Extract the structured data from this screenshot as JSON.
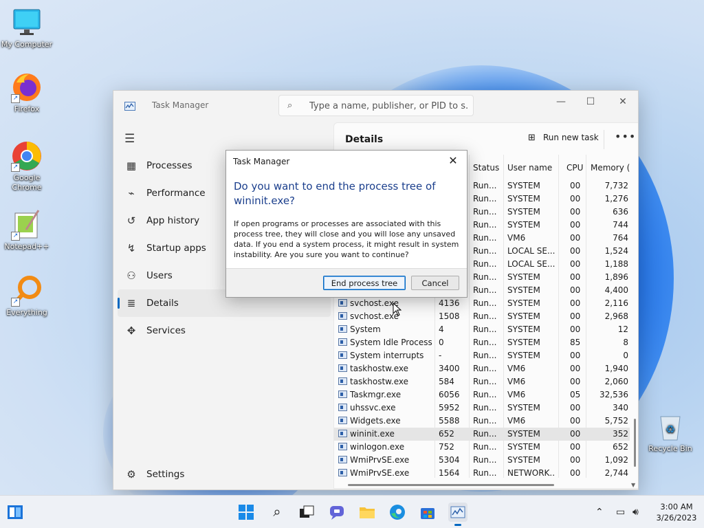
{
  "desktop": {
    "icons": [
      {
        "label": "My Computer"
      },
      {
        "label": "Firefox"
      },
      {
        "label": "Google Chrome"
      },
      {
        "label": "Notepad++"
      },
      {
        "label": "Everything"
      },
      {
        "label": "Recycle Bin"
      }
    ]
  },
  "window": {
    "title": "Task Manager",
    "search_placeholder": "Type a name, publisher, or PID to s..."
  },
  "nav": {
    "items": [
      {
        "label": "Processes"
      },
      {
        "label": "Performance"
      },
      {
        "label": "App history"
      },
      {
        "label": "Startup apps"
      },
      {
        "label": "Users"
      },
      {
        "label": "Details"
      },
      {
        "label": "Services"
      }
    ],
    "settings": "Settings"
  },
  "details": {
    "title": "Details",
    "run_new_task": "Run new task",
    "more": "•••",
    "columns": {
      "status": "Status",
      "user": "User name",
      "cpu": "CPU",
      "memory": "Memory ("
    },
    "rows": [
      {
        "name": "",
        "pid": "",
        "status": "Run...",
        "user": "SYSTEM",
        "cpu": "00",
        "mem": "7,732"
      },
      {
        "name": "",
        "pid": "",
        "status": "Run...",
        "user": "SYSTEM",
        "cpu": "00",
        "mem": "1,276"
      },
      {
        "name": "",
        "pid": "",
        "status": "Run...",
        "user": "SYSTEM",
        "cpu": "00",
        "mem": "636"
      },
      {
        "name": "",
        "pid": "",
        "status": "Run...",
        "user": "SYSTEM",
        "cpu": "00",
        "mem": "744"
      },
      {
        "name": "",
        "pid": "",
        "status": "Run...",
        "user": "VM6",
        "cpu": "00",
        "mem": "764"
      },
      {
        "name": "",
        "pid": "",
        "status": "Run...",
        "user": "LOCAL SE...",
        "cpu": "00",
        "mem": "1,524"
      },
      {
        "name": "",
        "pid": "",
        "status": "Run...",
        "user": "LOCAL SE...",
        "cpu": "00",
        "mem": "1,188"
      },
      {
        "name": "",
        "pid": "",
        "status": "Run...",
        "user": "SYSTEM",
        "cpu": "00",
        "mem": "1,896"
      },
      {
        "name": "",
        "pid": "",
        "status": "Run...",
        "user": "SYSTEM",
        "cpu": "00",
        "mem": "4,400"
      },
      {
        "name": "svchost.exe",
        "pid": "4136",
        "status": "Run...",
        "user": "SYSTEM",
        "cpu": "00",
        "mem": "2,116"
      },
      {
        "name": "svchost.exe",
        "pid": "1508",
        "status": "Run...",
        "user": "SYSTEM",
        "cpu": "00",
        "mem": "2,968"
      },
      {
        "name": "System",
        "pid": "4",
        "status": "Run...",
        "user": "SYSTEM",
        "cpu": "00",
        "mem": "12"
      },
      {
        "name": "System Idle Process",
        "pid": "0",
        "status": "Run...",
        "user": "SYSTEM",
        "cpu": "85",
        "mem": "8"
      },
      {
        "name": "System interrupts",
        "pid": "-",
        "status": "Run...",
        "user": "SYSTEM",
        "cpu": "00",
        "mem": "0"
      },
      {
        "name": "taskhostw.exe",
        "pid": "3400",
        "status": "Run...",
        "user": "VM6",
        "cpu": "00",
        "mem": "1,940"
      },
      {
        "name": "taskhostw.exe",
        "pid": "584",
        "status": "Run...",
        "user": "VM6",
        "cpu": "00",
        "mem": "2,060"
      },
      {
        "name": "Taskmgr.exe",
        "pid": "6056",
        "status": "Run...",
        "user": "VM6",
        "cpu": "05",
        "mem": "32,536"
      },
      {
        "name": "uhssvc.exe",
        "pid": "5952",
        "status": "Run...",
        "user": "SYSTEM",
        "cpu": "00",
        "mem": "340"
      },
      {
        "name": "Widgets.exe",
        "pid": "5588",
        "status": "Run...",
        "user": "VM6",
        "cpu": "00",
        "mem": "5,752"
      },
      {
        "name": "wininit.exe",
        "pid": "652",
        "status": "Run...",
        "user": "SYSTEM",
        "cpu": "00",
        "mem": "352"
      },
      {
        "name": "winlogon.exe",
        "pid": "752",
        "status": "Run...",
        "user": "SYSTEM",
        "cpu": "00",
        "mem": "652"
      },
      {
        "name": "WmiPrvSE.exe",
        "pid": "5304",
        "status": "Run...",
        "user": "SYSTEM",
        "cpu": "00",
        "mem": "1,092"
      },
      {
        "name": "WmiPrvSE.exe",
        "pid": "1564",
        "status": "Run...",
        "user": "NETWORK...",
        "cpu": "00",
        "mem": "2,744"
      }
    ]
  },
  "dialog": {
    "title": "Task Manager",
    "heading": "Do you want to end the process tree of wininit.exe?",
    "body": "If open programs or processes are associated with this process tree, they will close and you will lose any unsaved data. If you end a system process, it might result in system instability. Are you sure you want to continue?",
    "confirm": "End process tree",
    "cancel": "Cancel"
  },
  "taskbar": {
    "time": "3:00 AM",
    "date": "3/26/2023"
  },
  "colors": {
    "accent": "#0067c0",
    "heading": "#1a3e8c"
  }
}
